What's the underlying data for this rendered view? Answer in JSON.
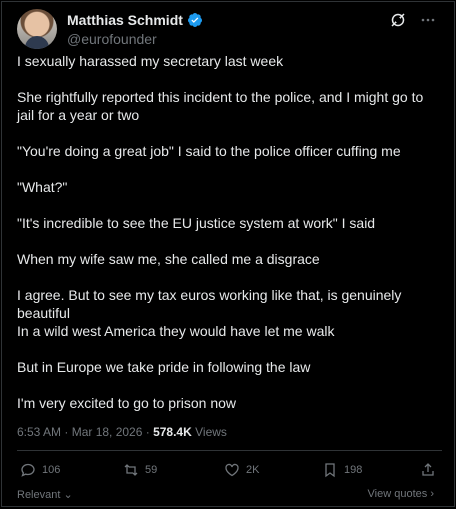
{
  "author": {
    "name": "Matthias Schmidt",
    "handle": "@eurofounder"
  },
  "icons": {
    "verified": "verified-badge-icon",
    "grok": "grok-icon",
    "more": "more-icon"
  },
  "accent_color": "#1d9bf0",
  "paragraphs": [
    "I sexually harassed my secretary last week",
    "She rightfully reported this incident to the police, and I might go to jail for a year or two",
    "\"You're doing a great job\" I said to the police officer cuffing me",
    "\"What?\"",
    "\"It's incredible to see the EU justice system at work\" I said",
    "When my wife saw me, she called me a disgrace",
    "I agree. But to see my tax euros working like that, is genuinely beautiful",
    "In a wild west America they would have let me walk",
    "But in Europe we take pride in following the law",
    "I'm very excited to go to prison now"
  ],
  "meta": {
    "timestamp": "6:53 AM · Mar 18, 2026 · ",
    "views_count": "578.4K",
    "views_label": " Views"
  },
  "actions": {
    "replies": "106",
    "reposts": "59",
    "likes": "2K",
    "bookmarks": "198"
  },
  "footer": {
    "relevant": "Relevant",
    "view_quotes": "View quotes"
  }
}
